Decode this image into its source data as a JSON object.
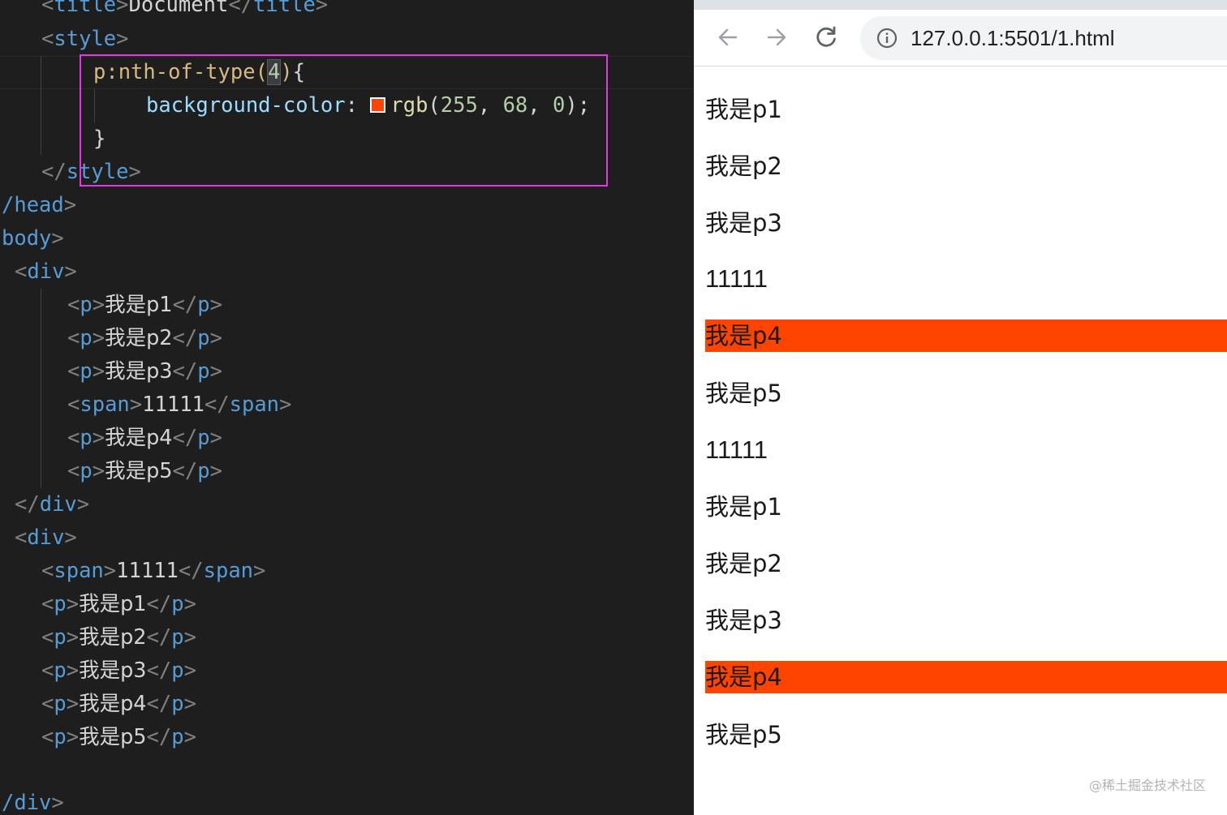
{
  "editor": {
    "lines": {
      "l1": {
        "open": "<",
        "tag": "title",
        "close": ">",
        "text": "Document",
        "end_open": "</",
        "end_tag": "title",
        "end_close": ">"
      },
      "l2": {
        "open": "<",
        "tag": "style",
        "close": ">"
      },
      "l3": {
        "selector": "p:nth-of-type(",
        "arg": "4",
        "close_paren": ")",
        "brace": "{"
      },
      "l4": {
        "property": "background-color",
        "colon": ": ",
        "fn": "rgb",
        "open": "(",
        "v1": "255",
        "comma1": ", ",
        "v2": "68",
        "comma2": ", ",
        "v3": "0",
        "close": ")",
        "semi": ";"
      },
      "l5": {
        "brace": "}"
      },
      "l6": {
        "open": "</",
        "tag": "style",
        "close": ">"
      },
      "l7": {
        "tag": "/head",
        "close": ">"
      },
      "l8": {
        "tag": "body",
        "close": ">"
      },
      "l9": {
        "open": "<",
        "tag": "div",
        "close": ">"
      },
      "l10": {
        "open": "<",
        "tag": "p",
        "close": ">",
        "text": "我是p1",
        "end_open": "</",
        "end_tag": "p",
        "end_close": ">"
      },
      "l11": {
        "open": "<",
        "tag": "p",
        "close": ">",
        "text": "我是p2",
        "end_open": "</",
        "end_tag": "p",
        "end_close": ">"
      },
      "l12": {
        "open": "<",
        "tag": "p",
        "close": ">",
        "text": "我是p3",
        "end_open": "</",
        "end_tag": "p",
        "end_close": ">"
      },
      "l13": {
        "open": "<",
        "tag": "span",
        "close": ">",
        "text": "11111",
        "end_open": "</",
        "end_tag": "span",
        "end_close": ">"
      },
      "l14": {
        "open": "<",
        "tag": "p",
        "close": ">",
        "text": "我是p4",
        "end_open": "</",
        "end_tag": "p",
        "end_close": ">"
      },
      "l15": {
        "open": "<",
        "tag": "p",
        "close": ">",
        "text": "我是p5",
        "end_open": "</",
        "end_tag": "p",
        "end_close": ">"
      },
      "l16": {
        "open": "</",
        "tag": "div",
        "close": ">"
      },
      "l17": {
        "open": "<",
        "tag": "div",
        "close": ">"
      },
      "l18": {
        "open": "<",
        "tag": "span",
        "close": ">",
        "text": "11111",
        "end_open": "</",
        "end_tag": "span",
        "end_close": ">"
      },
      "l19": {
        "open": "<",
        "tag": "p",
        "close": ">",
        "text": "我是p1",
        "end_open": "</",
        "end_tag": "p",
        "end_close": ">"
      },
      "l20": {
        "open": "<",
        "tag": "p",
        "close": ">",
        "text": "我是p2",
        "end_open": "</",
        "end_tag": "p",
        "end_close": ">"
      },
      "l21": {
        "open": "<",
        "tag": "p",
        "close": ">",
        "text": "我是p3",
        "end_open": "</",
        "end_tag": "p",
        "end_close": ">"
      },
      "l22": {
        "open": "<",
        "tag": "p",
        "close": ">",
        "text": "我是p4",
        "end_open": "</",
        "end_tag": "p",
        "end_close": ">"
      },
      "l23": {
        "open": "<",
        "tag": "p",
        "close": ">",
        "text": "我是p5",
        "end_open": "</",
        "end_tag": "p",
        "end_close": ">"
      },
      "l24": {
        "tag": "/div",
        "close": ">"
      }
    },
    "swatch_color": "#ff4400",
    "highlight_color": "#e535e5"
  },
  "browser": {
    "back_icon": "arrow-left-icon",
    "forward_icon": "arrow-right-icon",
    "reload_icon": "reload-icon",
    "info_icon": "info-icon",
    "url": "127.0.0.1:5501/1.html",
    "page_items": [
      {
        "text": "我是p1",
        "highlighted": false
      },
      {
        "text": "我是p2",
        "highlighted": false
      },
      {
        "text": "我是p3",
        "highlighted": false
      },
      {
        "text": "11111",
        "highlighted": false
      },
      {
        "text": "我是p4",
        "highlighted": true
      },
      {
        "text": "我是p5",
        "highlighted": false
      },
      {
        "text": "11111",
        "highlighted": false
      },
      {
        "text": "我是p1",
        "highlighted": false
      },
      {
        "text": "我是p2",
        "highlighted": false
      },
      {
        "text": "我是p3",
        "highlighted": false
      },
      {
        "text": "我是p4",
        "highlighted": true
      },
      {
        "text": "我是p5",
        "highlighted": false
      }
    ],
    "highlight_color": "#ff4400"
  },
  "watermark": "@稀土掘金技术社区"
}
